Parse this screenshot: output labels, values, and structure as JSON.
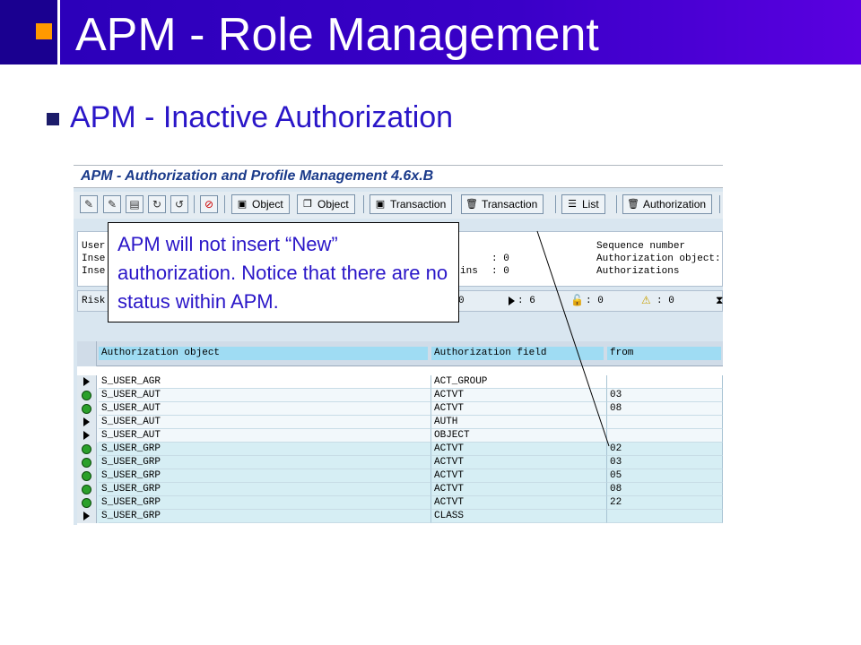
{
  "slide": {
    "title": "APM - Role Management",
    "subtitle": "APM - Inactive  Authorization"
  },
  "colors": {
    "title_bg": "#3a00c8",
    "accent_square": "#ff9900",
    "subtitle_text": "#2a16c8",
    "table_header_cell": "#9fdcf3",
    "status_green": "#2aa02a"
  },
  "sap": {
    "window_title": "APM - Authorization and Profile Management 4.6x.B",
    "toolbar": {
      "buttons": [
        {
          "label": "Object",
          "icon": "object-icon"
        },
        {
          "label": "Object",
          "icon": "object-icon"
        },
        {
          "label": "Transaction",
          "icon": "transaction-icon"
        },
        {
          "label": "Transaction",
          "icon": "trash-icon"
        },
        {
          "label": "List",
          "icon": "list-icon"
        },
        {
          "label": "Authorization",
          "icon": "trash-icon"
        }
      ]
    },
    "info": {
      "left_labels": [
        "User",
        "Inse",
        "Inse"
      ],
      "mid_values": [
        ":  0",
        ":  0"
      ],
      "mid_label": "ins",
      "right_labels": [
        "Sequence number",
        "Authorization object:",
        "Authorizations"
      ]
    },
    "risk": {
      "label": "Risk",
      "zero_value": "0",
      "arrow_count": ": 6",
      "lock_count": ": 0",
      "warning_count": ": 0"
    },
    "table": {
      "columns": [
        "Authorization object",
        "Authorization field",
        "from"
      ],
      "rows": [
        {
          "status": "arrow",
          "object": "S_USER_AGR",
          "field": "ACT_GROUP",
          "from": ""
        },
        {
          "status": "green",
          "object": "S_USER_AUT",
          "field": "ACTVT",
          "from": "03"
        },
        {
          "status": "green",
          "object": "S_USER_AUT",
          "field": "ACTVT",
          "from": "08"
        },
        {
          "status": "arrow",
          "object": "S_USER_AUT",
          "field": "AUTH",
          "from": ""
        },
        {
          "status": "arrow",
          "object": "S_USER_AUT",
          "field": "OBJECT",
          "from": ""
        },
        {
          "status": "green",
          "object": "S_USER_GRP",
          "field": "ACTVT",
          "from": "02"
        },
        {
          "status": "green",
          "object": "S_USER_GRP",
          "field": "ACTVT",
          "from": "03"
        },
        {
          "status": "green",
          "object": "S_USER_GRP",
          "field": "ACTVT",
          "from": "05"
        },
        {
          "status": "green",
          "object": "S_USER_GRP",
          "field": "ACTVT",
          "from": "08"
        },
        {
          "status": "green",
          "object": "S_USER_GRP",
          "field": "ACTVT",
          "from": "22"
        },
        {
          "status": "arrow",
          "object": "S_USER_GRP",
          "field": "CLASS",
          "from": ""
        }
      ]
    }
  },
  "callout": {
    "text": "APM will not insert “New” authorization.  Notice that there are no status within APM."
  }
}
